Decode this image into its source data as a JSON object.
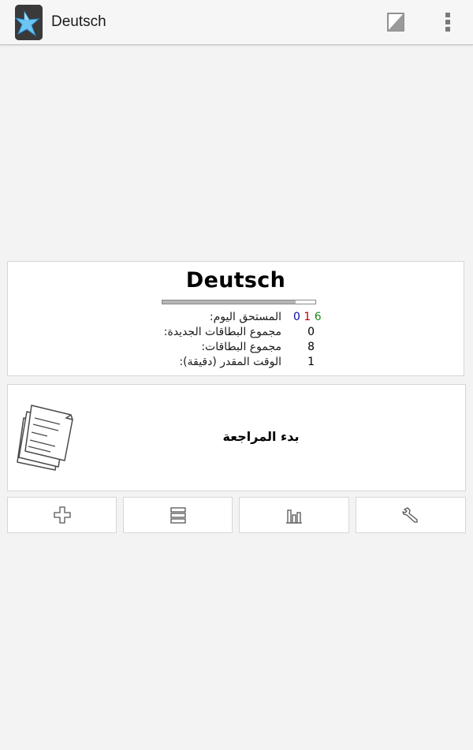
{
  "app": {
    "title": "Deutsch",
    "icons": {
      "app": "anki-star-icon",
      "edit": "edit-note-icon",
      "menu": "overflow-menu-icon"
    }
  },
  "deck": {
    "name": "Deutsch",
    "progress_fraction": 0.87,
    "stats": {
      "due_today": {
        "label": "المستحق اليوم:",
        "new": "0",
        "learn": "1",
        "review": "6"
      },
      "total_new": {
        "label": "مجموع البطاقات الجديدة:",
        "value": "0"
      },
      "total_cards": {
        "label": "مجموع البطاقات:",
        "value": "8"
      },
      "estimated_time": {
        "label": "الوقت المقدر (دقيقة):",
        "value": "1"
      }
    },
    "colors": {
      "new": "#0a0aa0",
      "learn": "#c00000",
      "review": "#1a8a1a"
    }
  },
  "study": {
    "label": "بدء المراجعة",
    "icon": "study-cards-icon"
  },
  "toolbar": {
    "buttons": [
      {
        "icon": "add-icon"
      },
      {
        "icon": "browse-list-icon"
      },
      {
        "icon": "statistics-icon"
      },
      {
        "icon": "wrench-icon"
      }
    ]
  }
}
